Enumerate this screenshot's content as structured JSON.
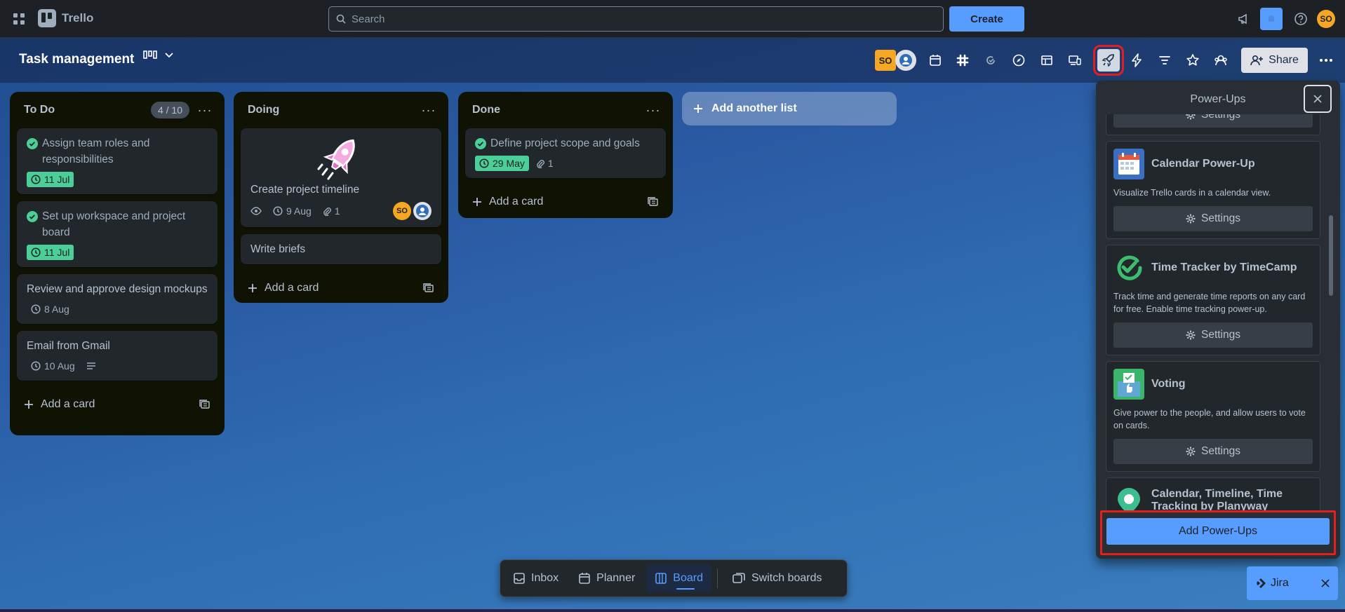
{
  "topnav": {
    "app_name": "Trello",
    "search_placeholder": "Search",
    "create_label": "Create",
    "user_initials": "SO"
  },
  "board": {
    "title": "Task management",
    "share_label": "Share",
    "member_initials": "SO"
  },
  "lists": [
    {
      "title": "To Do",
      "count": "4 / 10",
      "add_card_label": "Add a card",
      "cards": [
        {
          "title": "Assign team roles and responsibilities",
          "done": true,
          "date": "11 Jul"
        },
        {
          "title": "Set up workspace and project board",
          "done": true,
          "date": "11 Jul"
        },
        {
          "title": "Review and approve design mockups",
          "done": false,
          "date": "8 Aug"
        },
        {
          "title": "Email from Gmail",
          "done": false,
          "date": "10 Aug"
        }
      ]
    },
    {
      "title": "Doing",
      "add_card_label": "Add a card",
      "cards": [
        {
          "title": "Create project timeline",
          "date": "9 Aug",
          "attachments": "1",
          "member": "SO"
        },
        {
          "title": "Write briefs"
        }
      ]
    },
    {
      "title": "Done",
      "add_card_label": "Add a card",
      "cards": [
        {
          "title": "Define project scope and goals",
          "done": true,
          "date": "29 May",
          "attachments": "1"
        }
      ]
    }
  ],
  "add_list_label": "Add another list",
  "powerups": {
    "title": "Power-Ups",
    "settings_label": "Settings",
    "items": [
      {
        "name": "Calendar Power-Up",
        "desc": "Visualize Trello cards in a calendar view."
      },
      {
        "name": "Time Tracker by TimeCamp",
        "desc": "Track time and generate time reports on any card for free. Enable time tracking power-up."
      },
      {
        "name": "Voting",
        "desc": "Give power to the people, and allow users to vote on cards."
      },
      {
        "name": "Calendar, Timeline, Time Tracking by Planyway"
      }
    ],
    "add_label": "Add Power-Ups"
  },
  "bottom_nav": {
    "inbox": "Inbox",
    "planner": "Planner",
    "board": "Board",
    "switch_boards": "Switch boards"
  },
  "jira_label": "Jira",
  "colors": {
    "accent": "#579dff",
    "done_green": "#4bce97",
    "member_orange": "#f5a623",
    "highlight_red": "#e02020"
  }
}
